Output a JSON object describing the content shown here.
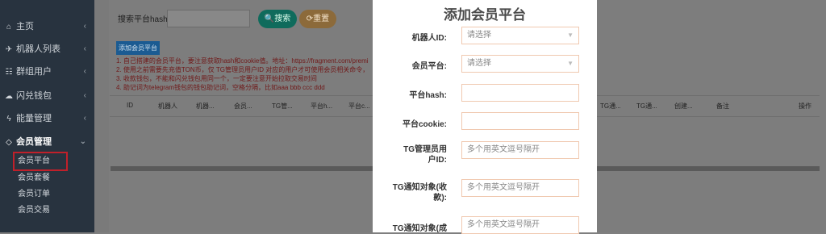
{
  "sidebar": {
    "items": [
      {
        "label": "主页",
        "icon": "home-icon",
        "glyph": "⌂",
        "chev": "‹"
      },
      {
        "label": "机器人列表",
        "icon": "plane-icon",
        "glyph": "✈",
        "chev": "‹"
      },
      {
        "label": "群组用户",
        "icon": "users-icon",
        "glyph": "☷",
        "chev": "‹"
      },
      {
        "label": "闪兑钱包",
        "icon": "cloud-icon",
        "glyph": "☁",
        "chev": "‹"
      },
      {
        "label": "能量管理",
        "icon": "bolt-icon",
        "glyph": "ϟ",
        "chev": "‹"
      },
      {
        "label": "会员管理",
        "icon": "diamond-icon",
        "glyph": "◇",
        "chev": "⌄"
      }
    ],
    "sub_items": [
      "会员平台",
      "会员套餐",
      "会员订单",
      "会员交易"
    ]
  },
  "search": {
    "label": "搜索平台hash:",
    "search_button": "🔍搜索",
    "reset_button": "⟳重置"
  },
  "toolbar": {
    "add_button": "添加会员平台"
  },
  "notes": [
    "1. 自己搭建的会员平台，要注意获取hash和cookie值。地址：https://fragment.com/premi",
    "2. 使用之前需要先充值TON币，仅 TG管理员用户ID 对应的用户才可使用会员相关命令，",
    "3. 收款钱包，不能和闪兑钱包用同一个，一定要注意开始拉取交易时间",
    "4. 助记词为telegram钱包的钱包助记词，空格分隔，比如aaa bbb ccc ddd"
  ],
  "table": {
    "left_headers": [
      "ID",
      "机器人",
      "机器...",
      "会员...",
      "TG管...",
      "平台h...",
      "平台c..."
    ],
    "right_headers": [
      "TG通...",
      "TG通...",
      "创建...",
      "备注",
      "操作"
    ]
  },
  "modal": {
    "title": "添加会员平台",
    "fields": [
      {
        "label": "机器人ID:",
        "value": "请选择",
        "type": "select"
      },
      {
        "label": "会员平台:",
        "value": "请选择",
        "type": "select"
      },
      {
        "label": "平台hash:",
        "value": "",
        "type": "input"
      },
      {
        "label": "平台cookie:",
        "value": "",
        "type": "input"
      },
      {
        "label": "TG管理员用户ID:",
        "value": "多个用英文逗号隔开",
        "type": "input"
      },
      {
        "label": "TG通知对象(收款):",
        "value": "多个用英文逗号隔开",
        "type": "input"
      },
      {
        "label": "TG通知对象(成",
        "value": "多个用英文逗号隔开",
        "type": "input"
      }
    ]
  },
  "colors": {
    "sidebar_bg": "#2f3b47",
    "modal_bg": "#ffffff",
    "accent_red": "#c0202a"
  }
}
